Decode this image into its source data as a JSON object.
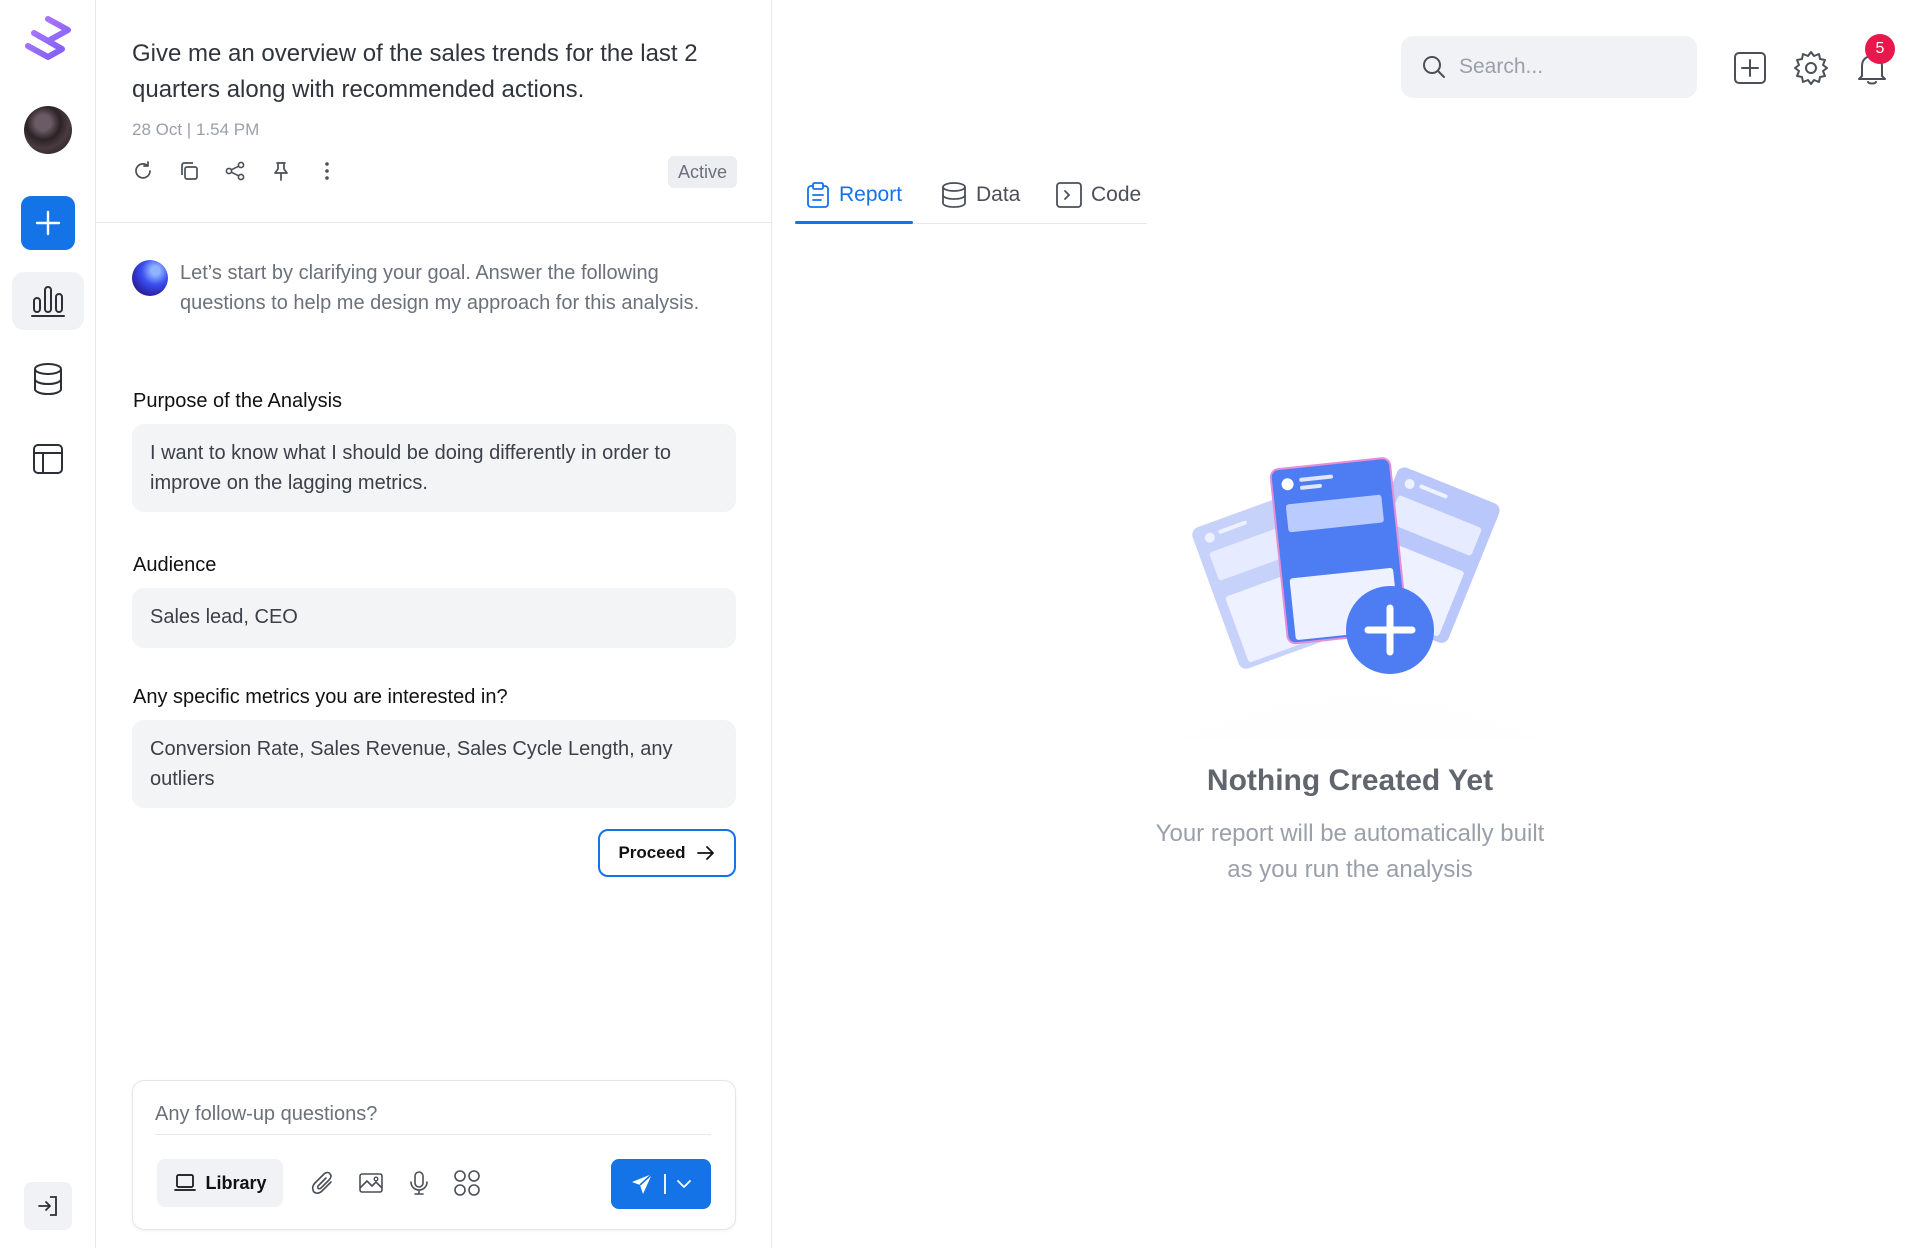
{
  "sidebar": {
    "logo": "app-logo",
    "items": [
      {
        "name": "new-analysis",
        "icon": "plus-icon"
      },
      {
        "name": "analytics",
        "icon": "bar-chart-icon",
        "active": true
      },
      {
        "name": "data",
        "icon": "database-icon"
      },
      {
        "name": "layout",
        "icon": "layout-icon"
      }
    ],
    "bottom_icon": "logout-icon"
  },
  "chat": {
    "prompt": "Give me an overview of the sales trends for the last 2 quarters along with recommended actions.",
    "meta": "28 Oct | 1.54 PM",
    "status": "Active",
    "bot_message": "Let’s start by clarifying your goal. Answer the following questions to help me design my approach for this analysis.",
    "questions": [
      {
        "label": "Purpose of the Analysis",
        "answer": "I want to know what I should be doing differently in order to improve on the lagging metrics."
      },
      {
        "label": "Audience",
        "answer": "Sales lead, CEO"
      },
      {
        "label": "Any specific metrics you are interested in?",
        "answer": "Conversion Rate, Sales Revenue, Sales Cycle Length, any outliers"
      }
    ],
    "proceed_label": "Proceed",
    "composer": {
      "placeholder": "Any follow-up questions?",
      "library_label": "Library"
    }
  },
  "header": {
    "search_placeholder": "Search...",
    "notification_count": "5"
  },
  "tabs": [
    {
      "label": "Report",
      "icon": "clipboard-icon",
      "active": true
    },
    {
      "label": "Data",
      "icon": "database-icon"
    },
    {
      "label": "Code",
      "icon": "terminal-icon"
    }
  ],
  "empty_state": {
    "title": "Nothing Created Yet",
    "subtitle": "Your report will be automatically built as you run the analysis"
  },
  "colors": {
    "accent": "#1473e6",
    "badge": "#e8174c"
  }
}
